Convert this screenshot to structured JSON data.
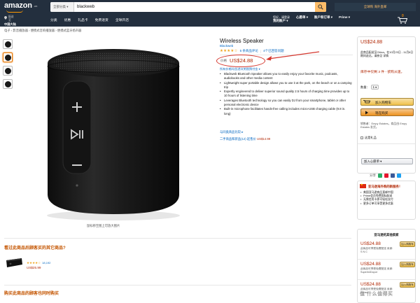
{
  "nav": {
    "logo": "amazon",
    "logo_cn": ".cn",
    "search_category": "全部分类 ▾",
    "search_query": "blackweb",
    "promo": "全球购 海外直邮",
    "deliver_line1": "配送至",
    "deliver_line2": "中国大陆",
    "links": [
      "分类",
      "优惠",
      "礼品卡",
      "免费退货",
      "全球开店"
    ],
    "right_items": [
      {
        "line1": "您好，请登录",
        "line2": "我的账户 ▾"
      },
      {
        "line1": "",
        "line2": "心愿单 ▾"
      },
      {
        "line1": "",
        "line2": "账户和订单 ▾"
      },
      {
        "line1": "",
        "line2": "Prime ▾"
      }
    ],
    "cart_count": "0",
    "cart_label": "购物车"
  },
  "breadcrumb": "电子 › 影音播放器 › 便携式音响播放器 › 便携式蓝牙扬声器",
  "product": {
    "zoom_hint": "鼠标移至图上可放大图片",
    "title": "Wireless Speaker",
    "brand": "Blackweb",
    "stars": "★★★★☆",
    "rating_link": "5 条商品评论",
    "qa_link": "4个已回答问题",
    "price_label": "价格",
    "price": "US$24.88",
    "tax_note": "所有价格均含进口关税预付金 ▾",
    "bullets": [
      "Blackweb Bluetooth Speaker allows you to easily enjoy your favorite music, podcasts, audiobooks and other media content",
      "Lightweight super portable design allows you to use it at the park, on the beach or on a camping trip",
      "Expertly engineered to deliver superior sound quality 2.5 hours of charging time provides up to 10 hours of listening time",
      "Leverages Bluetooth technology so you can easily DJ from your smartphone, tablet or other personal electronic device",
      "Built-in microphone facilitates hands-free calling includes micro-USB charging cable (9.8 in. long)"
    ],
    "compare_link": "与同类商品比较 ▸",
    "used_offer_prefix": "二手商品和新品(12) 起售价 ",
    "used_offer_price": "US$14.99"
  },
  "buybox": {
    "price": "US$24.88",
    "delivery": "此商品配送至China，在10月23日 - 11月6日期间送达。请参见 详情",
    "stock": "库存中仅剩 3 件 - 欲购从速。",
    "qty_label": "数量：",
    "qty_value": "1 ▾",
    "add_to_cart": "加入购物车",
    "buy_now": "现在购买",
    "ship_info": "销售者：Empy Estates，商品由 Empy Estates 发货。",
    "gift_label": "这是礼品",
    "wishlist": "加入心愿单 ▾",
    "share_label": "分享"
  },
  "promo_box": {
    "title": "亚马逊海外购的新服务！",
    "items": [
      "美国亚马逊商品直邮中国",
      "Prime会员免费国际配送",
      "无需信用卡即可轻松支付",
      "更多订单可享受更多优惠"
    ]
  },
  "sellers": {
    "title": "亚马逊的其他卖家",
    "list": [
      {
        "price": "US$24.88",
        "ship": "此商品可享受免费配送 卖家: S N C",
        "btn": "加入购物车"
      },
      {
        "price": "US$24.88",
        "ship": "此商品可享受免费配送 卖家: Superb4Dopot",
        "btn": "加入购物车"
      },
      {
        "price": "US$24.88",
        "ship": "此商品可享受免费配送 卖家: Sunset",
        "btn": "加入购物车"
      }
    ]
  },
  "related": {
    "title": "看过此商品后顾客买的其它商品?",
    "stars": "★★★★☆",
    "count": "18,192",
    "price": "US$25.99"
  },
  "bought_title": "购买此商品的顾客也同时购买",
  "watermark": "值 什么值得买",
  "colors": {
    "nav_bg": "#232f3e",
    "price_red": "#b12704",
    "link_blue": "#0066c0",
    "accent_orange": "#f90",
    "annotation_red": "#d5382f"
  },
  "icons": [
    "search-icon",
    "cart-icon",
    "location-pin-icon",
    "flag-cn-icon",
    "annotation-arrow-icon",
    "speaker-product-image"
  ]
}
